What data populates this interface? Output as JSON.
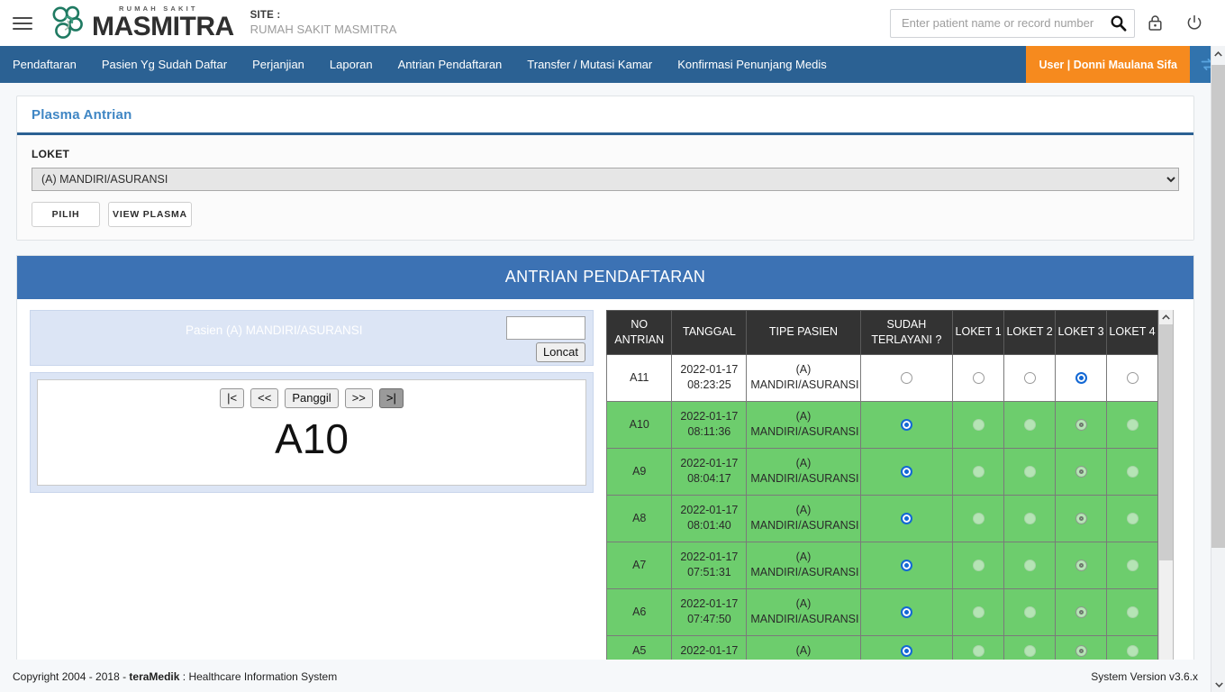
{
  "header": {
    "menu_icon": "hamburger-icon",
    "logo_kicker": "RUMAH SAKIT",
    "logo_word": "MASMITRA",
    "site_label": "SITE :",
    "site_value": "RUMAH SAKIT MASMITRA",
    "search_placeholder": "Enter patient name or record number",
    "search_value": "",
    "search_icon": "search-icon",
    "lock_icon": "lock-icon",
    "power_icon": "power-icon"
  },
  "nav": {
    "items": [
      {
        "label": "Pendaftaran"
      },
      {
        "label": "Pasien Yg Sudah Daftar"
      },
      {
        "label": "Perjanjian"
      },
      {
        "label": "Laporan"
      },
      {
        "label": "Antrian Pendaftaran"
      },
      {
        "label": "Transfer / Mutasi Kamar"
      },
      {
        "label": "Konfirmasi Penunjang Medis"
      }
    ],
    "user_badge": "User | Donni Maulana Sifa",
    "swap_icon": "swap-icon"
  },
  "plasma_panel": {
    "title": "Plasma Antrian",
    "loket_label": "LOKET",
    "loket_selected": "(A) MANDIRI/ASURANSI",
    "loket_options": [
      "(A) MANDIRI/ASURANSI"
    ],
    "btn_pilih": "PILIH",
    "btn_view_plasma": "VIEW PLASMA"
  },
  "antrian": {
    "heading": "ANTRIAN PENDAFTARAN",
    "caller_title": "Pasien (A) MANDIRI/ASURANSI",
    "jump_input_value": "",
    "btn_loncat": "Loncat",
    "nav_buttons": [
      {
        "label": "|<",
        "name": "first-button",
        "active": false
      },
      {
        "label": "<<",
        "name": "prev-button",
        "active": false
      },
      {
        "label": "Panggil",
        "name": "panggil-button",
        "active": false
      },
      {
        "label": ">>",
        "name": "next-button",
        "active": false
      },
      {
        "label": ">|",
        "name": "last-button",
        "active": true
      }
    ],
    "current_number": "A10"
  },
  "table": {
    "columns": [
      "NO ANTRIAN",
      "TANGGAL",
      "TIPE PASIEN",
      "SUDAH TERLAYANI ?",
      "LOKET 1",
      "LOKET 2",
      "LOKET 3",
      "LOKET 4"
    ],
    "rows": [
      {
        "no_antrian": "A11",
        "tanggal": "2022-01-17 08:23:25",
        "tipe_pasien": "(A) MANDIRI/ASURANSI",
        "served": false,
        "loket_selected": 3,
        "state": "active"
      },
      {
        "no_antrian": "A10",
        "tanggal": "2022-01-17 08:11:36",
        "tipe_pasien": "(A) MANDIRI/ASURANSI",
        "served": true,
        "loket_selected": 3,
        "state": "done"
      },
      {
        "no_antrian": "A9",
        "tanggal": "2022-01-17 08:04:17",
        "tipe_pasien": "(A) MANDIRI/ASURANSI",
        "served": true,
        "loket_selected": 3,
        "state": "done"
      },
      {
        "no_antrian": "A8",
        "tanggal": "2022-01-17 08:01:40",
        "tipe_pasien": "(A) MANDIRI/ASURANSI",
        "served": true,
        "loket_selected": 3,
        "state": "done"
      },
      {
        "no_antrian": "A7",
        "tanggal": "2022-01-17 07:51:31",
        "tipe_pasien": "(A) MANDIRI/ASURANSI",
        "served": true,
        "loket_selected": 3,
        "state": "done"
      },
      {
        "no_antrian": "A6",
        "tanggal": "2022-01-17 07:47:50",
        "tipe_pasien": "(A) MANDIRI/ASURANSI",
        "served": true,
        "loket_selected": 3,
        "state": "done"
      },
      {
        "no_antrian": "A5",
        "tanggal": "2022-01-17",
        "tipe_pasien": "(A)",
        "served": true,
        "loket_selected": 3,
        "state": "done"
      }
    ]
  },
  "footer": {
    "copyright_pre": "Copyright 2004 - 2018 - ",
    "copyright_brand": "teraMedik",
    "copyright_post": " : Healthcare Information System",
    "version": "System Version v3.6.x"
  },
  "colors": {
    "nav_blue": "#2b6193",
    "header_blue": "#3c72b4",
    "accent_orange": "#f68a1e",
    "row_green": "#6dcd6d",
    "panel_title_blue": "#3f86c4",
    "radio_blue": "#1368d4"
  }
}
